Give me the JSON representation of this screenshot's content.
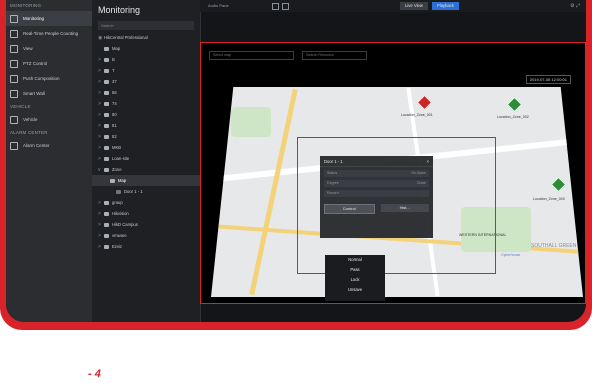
{
  "sidebar": {
    "sections": [
      {
        "title": "MONITORING",
        "items": [
          {
            "label": "Monitoring",
            "active": true
          },
          {
            "label": "Real-Time People Counting"
          },
          {
            "label": "View"
          },
          {
            "label": "PTZ Control"
          },
          {
            "label": "Push Composition"
          },
          {
            "label": "Smart Wall"
          }
        ]
      },
      {
        "title": "VEHICLE",
        "items": [
          {
            "label": "Vehicle"
          }
        ]
      },
      {
        "title": "ALARM CENTER",
        "items": [
          {
            "label": "Alarm Center"
          }
        ]
      }
    ]
  },
  "tree": {
    "title": "Monitoring",
    "search_placeholder": "Search",
    "root_label": "HikCentral Professional",
    "rows": [
      {
        "label": "Map",
        "level": 1,
        "chev": ""
      },
      {
        "label": "B",
        "level": 1,
        "chev": ">"
      },
      {
        "label": "T",
        "level": 1,
        "chev": ">"
      },
      {
        "label": "37",
        "level": 1,
        "chev": ">"
      },
      {
        "label": "56",
        "level": 1,
        "chev": ">"
      },
      {
        "label": "74",
        "level": 1,
        "chev": ">"
      },
      {
        "label": "80",
        "level": 1,
        "chev": ">"
      },
      {
        "label": "81",
        "level": 1,
        "chev": ">"
      },
      {
        "label": "82",
        "level": 1,
        "chev": ">"
      },
      {
        "label": "MKB",
        "level": 1,
        "chev": ">"
      },
      {
        "label": "Loan-site",
        "level": 1,
        "chev": ">"
      },
      {
        "label": "Zone",
        "level": 1,
        "chev": "v"
      },
      {
        "label": "Map",
        "level": 2,
        "chev": "",
        "selected": true
      },
      {
        "label": "Door 1 - 1",
        "level": 3,
        "chev": ""
      },
      {
        "label": "group",
        "level": 1,
        "chev": ">"
      },
      {
        "label": "Hikvision",
        "level": 1,
        "chev": ">"
      },
      {
        "label": "HikD Campus",
        "level": 1,
        "chev": ">"
      },
      {
        "label": "vmware",
        "level": 1,
        "chev": ">"
      },
      {
        "label": "Ezviz",
        "level": 1,
        "chev": ">"
      }
    ]
  },
  "topbar": {
    "audio_label": "Audio Pane",
    "live_view": "Live View",
    "playback": "Playback"
  },
  "map": {
    "input_left": "Select map",
    "input_right": "Search Resource",
    "clock": "2019-07-08 12:00:01",
    "markers": [
      {
        "label": "Location_Zone_001",
        "color": "red"
      },
      {
        "label": "Location_Zone_002",
        "color": "green"
      },
      {
        "label": "Location_Zone_003",
        "color": "green"
      }
    ],
    "area_labels": [
      "WESTERN INTERNATIONAL",
      "SOUTHALL GREEN",
      "Cyberhouse"
    ]
  },
  "popup": {
    "title": "Door 1 - 1",
    "rows": [
      {
        "left": "Status",
        "right": "No Alarm"
      },
      {
        "left": "Degree",
        "right": "Close"
      },
      {
        "left": "Record",
        "right": ""
      }
    ],
    "control_label": "Control",
    "history_label": "Hist..."
  },
  "dropdown": {
    "options": [
      "Normal",
      "Pass",
      "Lock",
      "Unsave"
    ]
  },
  "caption": {
    "text": "- 4"
  }
}
